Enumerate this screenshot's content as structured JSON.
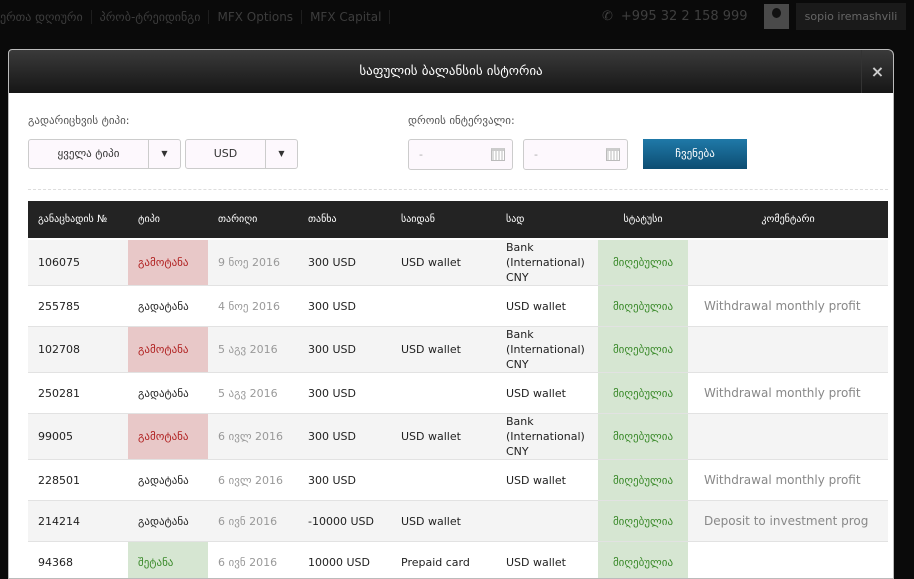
{
  "topbar": {
    "nav": [
      "ერთა დღიური",
      "პრობ-ტრეიდინგი",
      "MFX Options",
      "MFX Capital"
    ],
    "phone": "+995 32 2 158 999",
    "user": "sopio iremashvili"
  },
  "modal": {
    "title": "საფულის ბალანსის ისტორია",
    "close": "×"
  },
  "filters": {
    "type_label": "გადარიცხვის ტიპი:",
    "type_value": "ყველა ტიპი",
    "currency_value": "USD",
    "interval_label": "დროის ინტერვალი:",
    "from_value": "-",
    "to_value": "-",
    "show_button": "ჩვენება"
  },
  "table": {
    "headers": [
      "განაცხადის №",
      "ტიპი",
      "თარიღი",
      "თანხა",
      "საიდან",
      "სად",
      "სტატუსი",
      "კომენტარი"
    ],
    "rows": [
      {
        "id": "106075",
        "type": "გამოტანა",
        "kind": "out",
        "date": "9 ნოე 2016",
        "amount": "300 USD",
        "from": "USD wallet",
        "to": "Bank (International) CNY",
        "status": "მიღებულია",
        "comment": ""
      },
      {
        "id": "255785",
        "type": "გადატანა",
        "kind": "transfer",
        "date": "4 ნოე 2016",
        "amount": "300 USD",
        "from": "",
        "to": "USD wallet",
        "status": "მიღებულია",
        "comment": "Withdrawal monthly profit"
      },
      {
        "id": "102708",
        "type": "გამოტანა",
        "kind": "out",
        "date": "5 აგვ 2016",
        "amount": "300 USD",
        "from": "USD wallet",
        "to": "Bank (International) CNY",
        "status": "მიღებულია",
        "comment": ""
      },
      {
        "id": "250281",
        "type": "გადატანა",
        "kind": "transfer",
        "date": "5 აგვ 2016",
        "amount": "300 USD",
        "from": "",
        "to": "USD wallet",
        "status": "მიღებულია",
        "comment": "Withdrawal monthly profit"
      },
      {
        "id": "99005",
        "type": "გამოტანა",
        "kind": "out",
        "date": "6 ივლ 2016",
        "amount": "300 USD",
        "from": "USD wallet",
        "to": "Bank (International) CNY",
        "status": "მიღებულია",
        "comment": ""
      },
      {
        "id": "228501",
        "type": "გადატანა",
        "kind": "transfer",
        "date": "6 ივლ 2016",
        "amount": "300 USD",
        "from": "",
        "to": "USD wallet",
        "status": "მიღებულია",
        "comment": "Withdrawal monthly profit"
      },
      {
        "id": "214214",
        "type": "გადატანა",
        "kind": "transfer",
        "date": "6 ივნ 2016",
        "amount": "-10000 USD",
        "from": "USD wallet",
        "to": "",
        "status": "მიღებულია",
        "comment": "Deposit to investment prog"
      },
      {
        "id": "94368",
        "type": "შეტანა",
        "kind": "in",
        "date": "6 ივნ 2016",
        "amount": "10000 USD",
        "from": "Prepaid card",
        "to": "USD wallet",
        "status": "მიღებულია",
        "comment": ""
      }
    ]
  }
}
